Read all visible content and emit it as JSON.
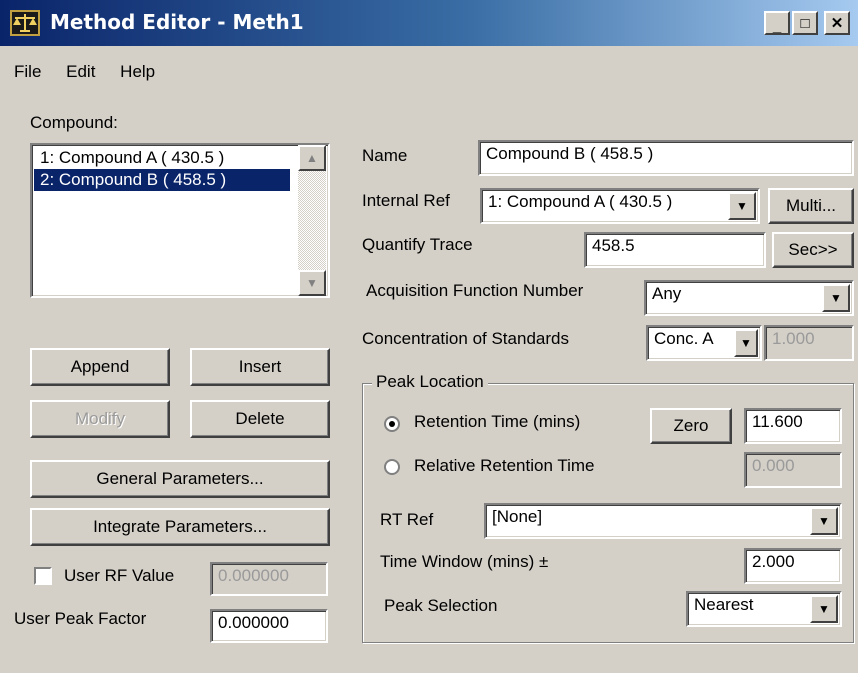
{
  "window": {
    "title": "Method Editor - Meth1",
    "controls": {
      "minimize": "_",
      "maximize": "□",
      "close": "✕"
    }
  },
  "menu": [
    "File",
    "Edit",
    "Help"
  ],
  "compound": {
    "label": "Compound:",
    "items": [
      "1: Compound A ( 430.5 )",
      "2: Compound B ( 458.5 )"
    ],
    "selected_index": 1
  },
  "buttons": {
    "append": "Append",
    "insert": "Insert",
    "modify": "Modify",
    "delete": "Delete",
    "general_parameters": "General Parameters...",
    "integrate_parameters": "Integrate Parameters..."
  },
  "user_rf": {
    "label": "User RF Value",
    "value": "0.000000",
    "checked": false
  },
  "user_peak_factor": {
    "label": "User Peak Factor",
    "value": "0.000000"
  },
  "name": {
    "label": "Name",
    "value": "Compound B ( 458.5 )"
  },
  "internal_ref": {
    "label": "Internal Ref",
    "value": "1: Compound A ( 430.5 )",
    "multi_button": "Multi..."
  },
  "quantify_trace": {
    "label": "Quantify Trace",
    "value": "458.5",
    "sec_button": "Sec>>"
  },
  "acquisition_function": {
    "label": "Acquisition Function Number",
    "value": "Any"
  },
  "concentration": {
    "label": "Concentration of Standards",
    "value": "Conc. A",
    "amount": "1.000"
  },
  "peak_location": {
    "label": "Peak Location",
    "retention_time": {
      "label": "Retention Time (mins)",
      "selected": true,
      "zero_button": "Zero",
      "value": "11.600"
    },
    "relative_retention_time": {
      "label": "Relative Retention Time",
      "selected": false,
      "value": "0.000"
    },
    "rt_ref": {
      "label": "RT Ref",
      "value": "[None]"
    },
    "time_window": {
      "label": "Time Window (mins) ±",
      "value": "2.000"
    },
    "peak_selection": {
      "label": "Peak Selection",
      "value": "Nearest"
    }
  }
}
